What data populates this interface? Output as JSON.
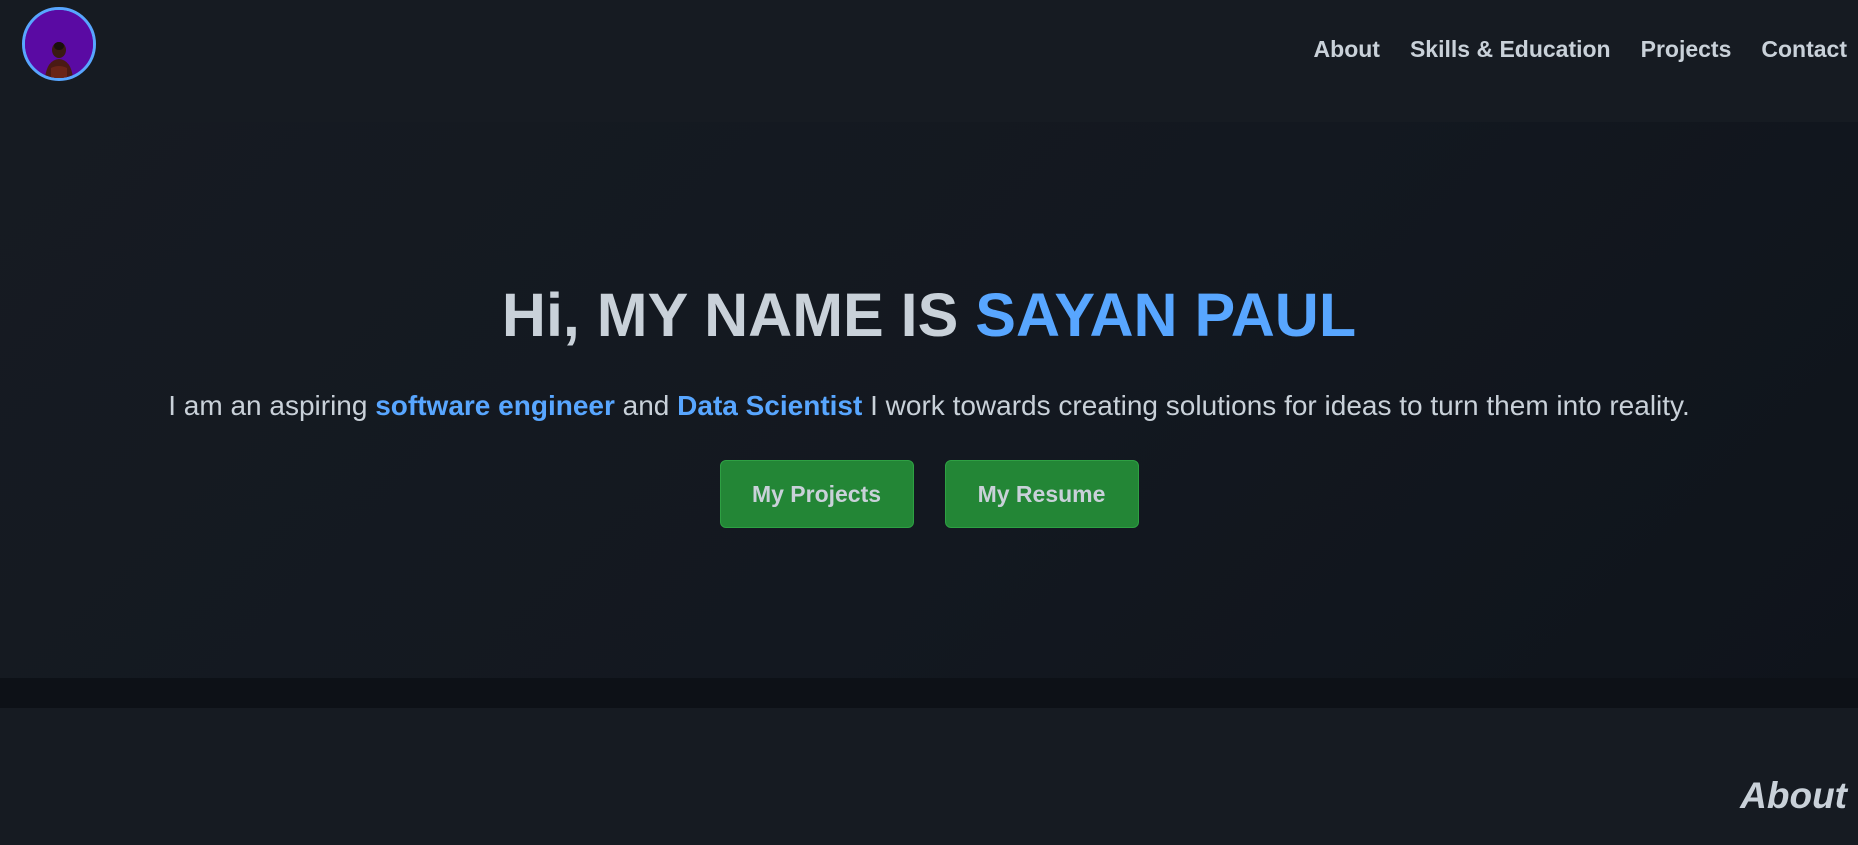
{
  "nav": {
    "items": [
      {
        "label": "About"
      },
      {
        "label": "Skills & Education"
      },
      {
        "label": "Projects"
      },
      {
        "label": "Contact"
      }
    ]
  },
  "hero": {
    "title_prefix": "Hi, MY NAME IS ",
    "title_name": "SAYAN PAUL",
    "subtitle": {
      "part1": "I am an aspiring ",
      "highlight1": "software engineer",
      "part2": " and ",
      "highlight2": "Data Scientist",
      "part3": " I work towards creating solutions for ideas to turn them into reality."
    },
    "buttons": {
      "projects_label": "My Projects",
      "resume_label": "My Resume"
    }
  },
  "about": {
    "heading": "About"
  },
  "colors": {
    "background": "#161b22",
    "accent": "#58a6ff",
    "text": "#c9d1d9",
    "button": "#238636",
    "avatar_background": "#5a0aa3"
  }
}
